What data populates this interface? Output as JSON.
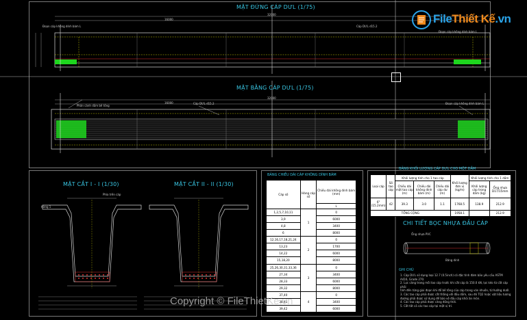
{
  "titles": {
    "elevation": "MẶT ĐỨNG CÁP DƯL (1/75)",
    "plan": "MẶT BẰNG CÁP DƯL (1/75)",
    "section1": "MẶT CẮT I - I (1/30)",
    "section2": "MẶT CẮT II - II (1/30)",
    "length_table": "BẢNG CHIỀU DÀI CÁP KHÔNG DÍNH BÁM",
    "volume_table": "BẢNG KHỐI LƯỢNG CÁP DƯL CHO MỘT DẦM",
    "detail": "CHI TIẾT BỌC NHỰA ĐẦU CÁP",
    "notes": "GHI CHÚ"
  },
  "logo": {
    "part1": "File",
    "part2": "Thiết Kế",
    "part3": ".vn"
  },
  "watermark": "Copyright © FileThietKe.vn",
  "dims": {
    "total": "32000",
    "half": "16000"
  },
  "labels": {
    "elev_left": "Đoạn cáp không dính bám L",
    "elev_right": "Cáp DƯL d15.2",
    "elev_right2": "Đoạn cáp không dính bám L",
    "plan_left": "Phân cánh dầm bê tông",
    "plan_mid": "Cáp DƯL d15.2",
    "plan_right": "Đoạn cáp không dính bám L",
    "sec_left": "Hàng 1",
    "sec_mid": "Phía trên cáp",
    "detail_label": "Ống nhựa PVC",
    "detail_right": "Băng dính"
  },
  "length_table": {
    "head_cap": "Cáp số",
    "head_row": "Hàng cáp số",
    "head_len": "Chiều dài không dính bám (mm)",
    "head_L": "L",
    "rows": [
      {
        "cap": "1,2,5,7,10,11",
        "len": "0"
      },
      {
        "cap": "3,9",
        "len": "6000"
      },
      {
        "cap": "4,8",
        "len": "3400"
      },
      {
        "cap": "6",
        "len": "8000"
      },
      {
        "cap": "12,16,17,18,21,24",
        "len": "0"
      },
      {
        "cap": "13,23",
        "len": "1700"
      },
      {
        "cap": "14,22",
        "len": "6000"
      },
      {
        "cap": "15,18,20",
        "len": "8000"
      },
      {
        "cap": "25,26,30,31,33,36",
        "len": "0"
      },
      {
        "cap": "27,34",
        "len": "3400"
      },
      {
        "cap": "28,33",
        "len": "6000"
      },
      {
        "cap": "29,32",
        "len": "8000"
      },
      {
        "cap": "37,40",
        "len": "0"
      },
      {
        "cap": "38,41",
        "len": "3400"
      },
      {
        "cap": "39,42",
        "len": "6000"
      }
    ],
    "groups": [
      "1",
      "2",
      "3",
      "4"
    ]
  },
  "volume_table": {
    "h1": "Loại cáp",
    "h2": "Số tao cáp",
    "h3": "Khối lượng tính cho 1 tao cáp",
    "h3a": "Chiều dài một tao cáp (m)",
    "h3b": "Chiều dài không dính bám (m)",
    "h3c": "Chiều dài cáp dư (m)",
    "h4": "Khối lượng đơn vị (kg/m)",
    "h5": "Khối lượng tính cho 1 dầm",
    "h5a": "Khối lượng cáp trong dầm (kg)",
    "h5b": "Ống nhựa PVC",
    "h5c": "Ống nhựa D17/15mm",
    "row": [
      "6\"(15.2mm)",
      "42",
      "39.3",
      "3.0",
      "1.1",
      "1768.5",
      "138.9",
      "212.9"
    ],
    "total_label": "TỔNG CỘNG",
    "total": [
      "1958.1",
      "",
      "212.9"
    ]
  },
  "notes": [
    "1. Cáp DƯL sử dụng loại 12.7 (0.5inch) có đặc tính đàm bảo yêu cầu ASTM",
    "A416, Grade 270.",
    "2. Lực căng trong mỗi tao cáp trước khi cắt cáp là 150.0 kN, lực kéo từ cắt cáp phải",
    "tính đến từng giai đoạn khi đổ bê tông của cáp trong ván khuôn, từ hướng dưới.",
    "3. Các tao cáp phải được cắt thẳng với đầu dầm, sau đó TQ2 hoặc vật liệu tương",
    "đương phải được sử dụng để bảo vệ đầu cáp khỏi ăn mòn.",
    "4. Các tao cáp phải được căng đồng thời.",
    "5. Cắt tất cả các tao cáp tại một vị trí."
  ]
}
